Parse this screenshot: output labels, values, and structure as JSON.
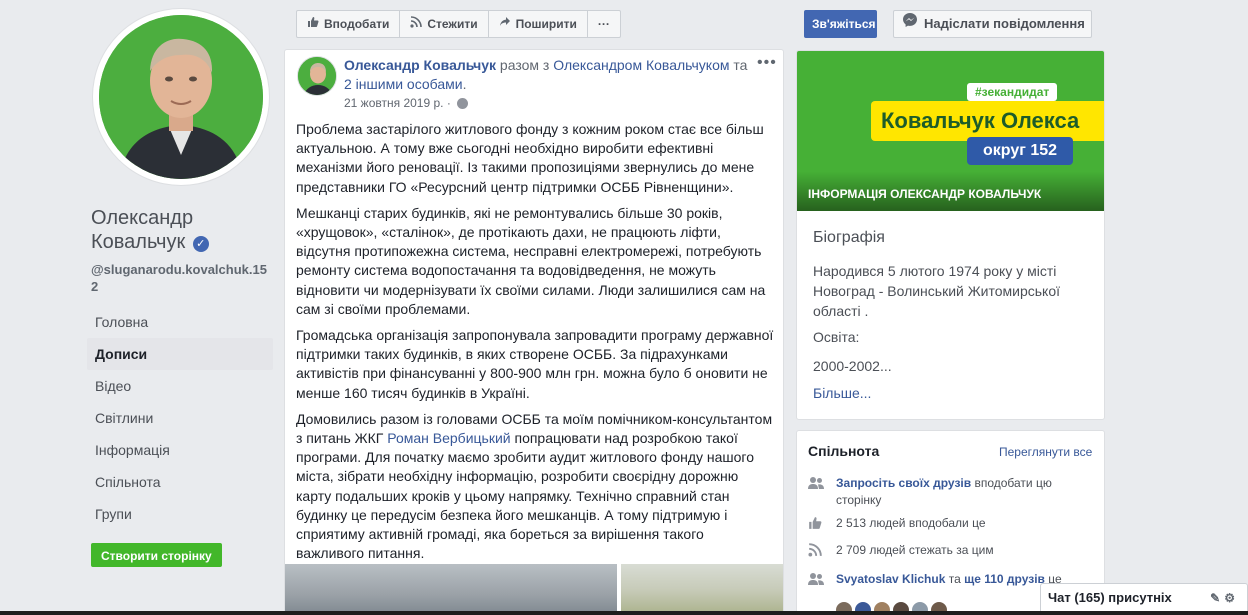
{
  "sidebar": {
    "name_line1": "Олександр",
    "name_line2": "Ковальчук",
    "verified_icon": "check-badge-icon",
    "handle": "@sluganarodu.kovalchuk.152",
    "nav": [
      {
        "label": "Головна"
      },
      {
        "label": "Дописи"
      },
      {
        "label": "Відео"
      },
      {
        "label": "Світлини"
      },
      {
        "label": "Інформація"
      },
      {
        "label": "Спільнота"
      },
      {
        "label": "Групи"
      }
    ],
    "create_page_label": "Створити сторінку"
  },
  "actionbar": {
    "like_label": "Вподобати",
    "follow_label": "Стежити",
    "share_label": "Поширити",
    "more_label": "···"
  },
  "contact_label": "Зв'яжіться з нами",
  "message_label": "Надіслати повідомлення",
  "post": {
    "author": "Олександр Ковальчук",
    "with_text": " разом з ",
    "with_link": "Олександром Ковальчуком",
    "and_text": " та ",
    "others_link": "2 іншими особами",
    "period": ".",
    "date": "21 жовтня 2019 р. ·",
    "menu": "•••",
    "p1": "Проблема застарілого житлового фонду з кожним роком стає все більш актуальною. А тому вже сьогодні необхідно виробити ефективні механізми його реновації. Із такими пропозиціями звернулись до мене представники ГО «Ресурсний центр підтримки ОСББ Рівненщини».",
    "p2": "Мешканці старих будинків, які не ремонтувались більше 30 років, «хрущовок», «сталінок», де протікають дахи, не працюють ліфти, відсутня протипожежна система, несправні електромережі, потребують ремонту система водопостачання та водовідведення, не можуть відновити чи модернізувати їх своїми силами. Люди залишилися сам на сам зі своїми проблемами.",
    "p3": "Громадська організація запропонувала запровадити програму державної підтримки таких будинків, в яких створене ОСББ. За підрахунками активістів при фінансуванні у 800-900 млн грн. можна було б оновити не менше 160 тисяч будинків в Україні.",
    "p4_a": "Домовились разом із головами ОСББ та моїм помічником-консультантом з питань ЖКГ ",
    "p4_mention": "Роман Вербицький",
    "p4_b": " попрацювати над розробкою такої програми. Для початку маємо зробити аудит житлового фонду нашого міста, зібрати необхідну інформацію, розробити своєрідну дорожню карту подальших кроків у цьому напрямку. Технічно справний стан будинку це передусім безпека його мешканців. А тому підтримую і сприятиму активній громаді, яка бореться за вирішення такого важливого питання."
  },
  "info": {
    "banner_tag": "#зекандидат",
    "banner_name": "Ковальчук Олекса",
    "banner_district": "округ 152",
    "banner_caption": "ІНФОРМАЦІЯ ОЛЕКСАНДР КОВАЛЬЧУК",
    "bio_title": "Біографія",
    "bio_text": "Народився 5 лютого 1974 року у місті Новоград - Волинський Житомирської області .",
    "edu": "Освіта:",
    "years": "2000-2002...",
    "more": "Більше..."
  },
  "community": {
    "title": "Спільнота",
    "see_all": "Переглянути все",
    "invite_link": "Запросіть своїх друзів",
    "invite_text": " вподобати цю сторінку",
    "likes": "2 513 людей вподобали це",
    "follows": "2 709 людей стежать за цим",
    "friend_link": "Svyatoslav Klichuk",
    "friend_mid": " та ",
    "friend_more": "ще 110 друзів",
    "friend_tail": " це"
  },
  "chat": {
    "label": "Чат (165) присутніх"
  }
}
